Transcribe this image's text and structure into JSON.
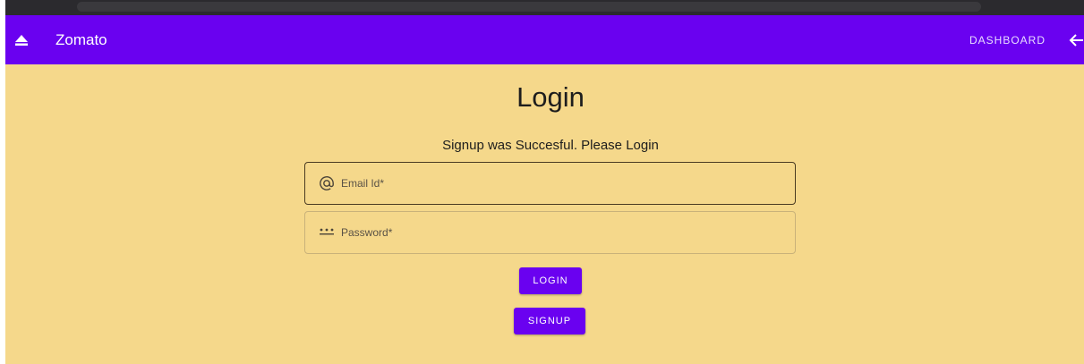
{
  "app": {
    "title": "Zomato",
    "dashboard_label": "DASHBOARD",
    "logo_icon": "eject-icon",
    "back_icon": "arrow-left-icon"
  },
  "login": {
    "heading": "Login",
    "notice": "Signup was Succesful. Please Login",
    "email": {
      "placeholder": "Email Id*",
      "value": "",
      "icon": "at-icon"
    },
    "password": {
      "placeholder": "Password*",
      "value": "",
      "icon": "password-dots-icon"
    },
    "login_label": "LOGIN",
    "signup_label": "SIGNUP"
  },
  "colors": {
    "primary": "#6a01f0",
    "background": "#f5d88b",
    "text": "#1d1d1d"
  }
}
